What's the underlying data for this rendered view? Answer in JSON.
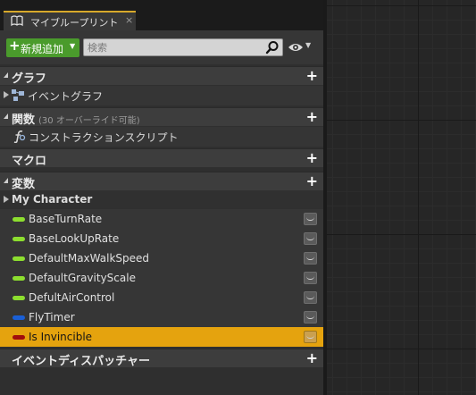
{
  "tab": {
    "title": "マイブループリント",
    "close": "×"
  },
  "toolbar": {
    "add_label": "新規追加",
    "search_placeholder": "検索"
  },
  "categories": {
    "graphs": {
      "title": "グラフ",
      "items": [
        "イベントグラフ"
      ]
    },
    "functions": {
      "title": "関数",
      "subtitle": "(30 オーバーライド可能)",
      "items": [
        "コンストラクションスクリプト"
      ]
    },
    "macros": {
      "title": "マクロ"
    },
    "variables": {
      "title": "変数",
      "group": "My Character",
      "items": [
        {
          "name": "BaseTurnRate",
          "color": "#8dde2f"
        },
        {
          "name": "BaseLookUpRate",
          "color": "#8dde2f"
        },
        {
          "name": "DefaultMaxWalkSpeed",
          "color": "#8dde2f"
        },
        {
          "name": "DefaultGravityScale",
          "color": "#8dde2f"
        },
        {
          "name": "DefultAirControl",
          "color": "#8dde2f"
        },
        {
          "name": "FlyTimer",
          "color": "#1a5fd6"
        },
        {
          "name": "Is Invincible",
          "color": "#a10d0d",
          "selected": true
        }
      ]
    },
    "dispatchers": {
      "title": "イベントディスパッチャー"
    }
  }
}
